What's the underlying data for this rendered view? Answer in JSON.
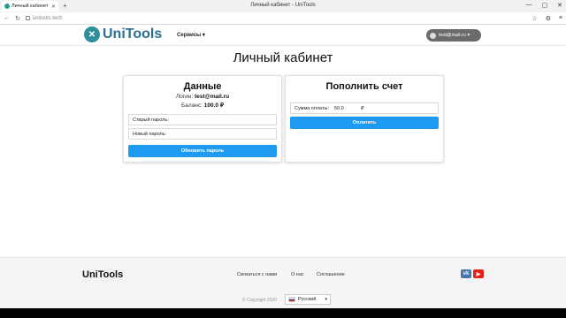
{
  "browser": {
    "tab_title": "Личный кабинет - UniT",
    "tab_close": "✕",
    "new_tab": "+",
    "window_title": "Личный кабинет - UniTools",
    "url": "unitools.tech",
    "controls": [
      "—",
      "▢",
      "✕"
    ]
  },
  "header": {
    "logo_text": "UniTools",
    "services_label": "Сервисы ▾",
    "user_email": "test@mail.ru ▾"
  },
  "page": {
    "title": "Личный кабинет"
  },
  "data_card": {
    "title": "Данные",
    "login_label": "Логин:",
    "login_value": "test@mail.ru",
    "balance_label": "Баланс:",
    "balance_value": "100.0 ₽",
    "old_password": "Старый пароль:",
    "new_password": "Новый пароль:",
    "update_button": "Обновить пароль"
  },
  "pay_card": {
    "title": "Пополнить счет",
    "amount_label": "Сумма оплаты:",
    "amount_value": "50.0",
    "currency": "₽",
    "pay_button": "Оплатить"
  },
  "footer": {
    "logo": "UniTools",
    "links": [
      "Связаться с нами",
      "О нас",
      "Соглашение"
    ],
    "copyright": "© Copyright 2020",
    "language": "Русский",
    "vk": "vk",
    "youtube": "▶",
    "colors": {
      "vk": "#4a76a8",
      "youtube": "#e62117"
    }
  }
}
